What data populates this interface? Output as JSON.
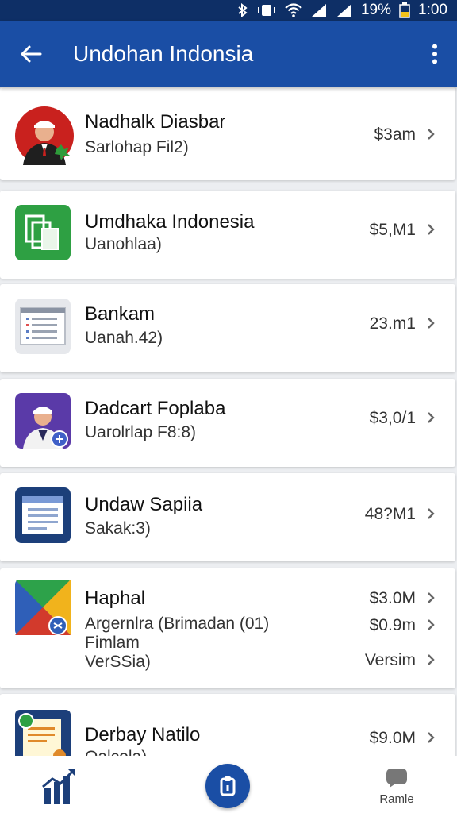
{
  "status_bar": {
    "battery": "19%",
    "time": "1:00",
    "icons": [
      "bluetooth-icon",
      "vibrate-icon",
      "wifi-icon",
      "signal-icon",
      "signal-icon",
      "battery-icon"
    ]
  },
  "app_bar": {
    "title": "Undohan Indonsia",
    "back_icon": "arrow-left-icon",
    "menu_icon": "more-vert-icon"
  },
  "items": [
    {
      "title": "Nadhalk Diasbar",
      "subtitle": "Sarlohap Fil2)",
      "value": "$3am",
      "icon": "man-avatar-red-icon"
    },
    {
      "title": "Umdhaka Indonesia",
      "subtitle": "Uanohlaa)",
      "value": "$5,M1",
      "icon": "green-documents-icon"
    },
    {
      "title": "Bankam",
      "subtitle": "Uanah.42)",
      "value": "23.m1",
      "icon": "list-document-icon"
    },
    {
      "title": "Dadcart Foplaba",
      "subtitle": "Uarolrlap F8:8)",
      "value": "$3,0/1",
      "icon": "man-avatar-purple-icon"
    },
    {
      "title": "Undaw Sapiia",
      "subtitle": "Sakak:3)",
      "value": "48?M1",
      "icon": "blue-document-icon"
    },
    {
      "title": "Haphal",
      "subtitle_lines": [
        "Argernlra (Brimadan  (01)",
        "Fimlam",
        "VerSSia)"
      ],
      "values": [
        "$3.0M",
        "$0.9m",
        "Versim"
      ],
      "icon": "play-store-icon"
    },
    {
      "title": "Derbay Natilo",
      "subtitle": "Oalcola)",
      "value": "$9.0M",
      "icon": "invoice-icon"
    }
  ],
  "bottom_nav": {
    "stats_icon": "bar-chart-icon",
    "center_icon": "clipboard-icon",
    "profile_label": "Ramle",
    "profile_icon": "person-icon"
  },
  "colors": {
    "primary": "#1a4ea5",
    "status_bar": "#0e2f66",
    "background": "#eceef1"
  }
}
